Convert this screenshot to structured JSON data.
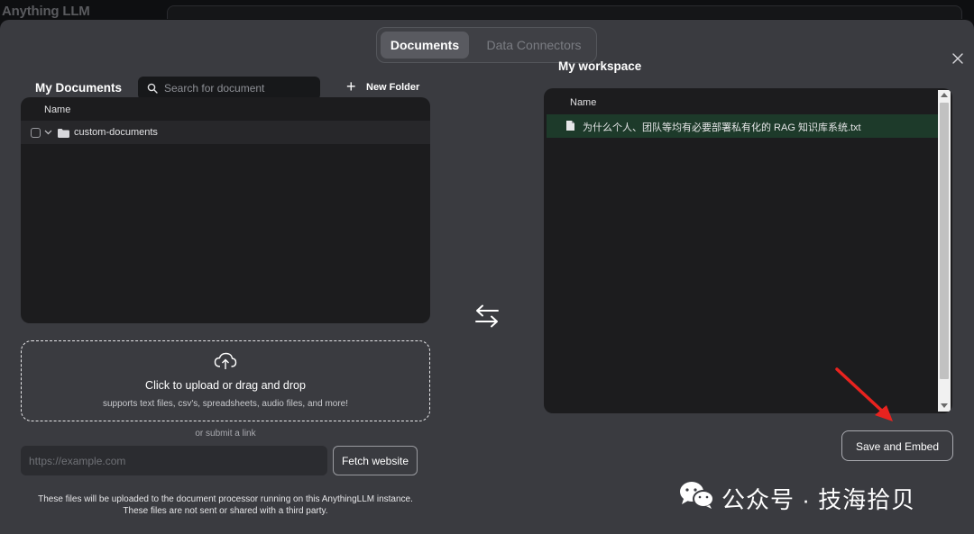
{
  "app": {
    "title": "Anything LLM"
  },
  "tabs": [
    {
      "label": "Documents",
      "active": true
    },
    {
      "label": "Data Connectors",
      "active": false
    }
  ],
  "left": {
    "heading": "My Documents",
    "search_placeholder": "Search for document",
    "new_folder_label": "New Folder",
    "column_name": "Name",
    "folders": [
      {
        "name": "custom-documents",
        "expanded": true,
        "checked": false
      }
    ],
    "upload": {
      "title": "Click to upload or drag and drop",
      "subtitle": "supports text files, csv's, spreadsheets, audio files, and more!"
    },
    "or_submit_link": "or submit a link",
    "url_placeholder": "https://example.com",
    "fetch_label": "Fetch website",
    "disclaimer_line1": "These files will be uploaded to the document processor running on this AnythingLLM instance.",
    "disclaimer_line2": "These files are not sent or shared with a third party."
  },
  "right": {
    "heading": "My workspace",
    "column_name": "Name",
    "files": [
      {
        "name": "为什么个人、团队等均有必要部署私有化的 RAG 知识库系统.txt"
      }
    ],
    "save_label": "Save and Embed"
  },
  "watermark": {
    "text": "公众号 · 技海拾贝"
  },
  "colors": {
    "modal_bg": "#3a3b40",
    "panel_bg": "#1c1c1e",
    "selected_row": "#1d3a2a",
    "annotation_arrow": "#e8231f"
  },
  "icons": [
    "close-icon",
    "search-icon",
    "plus-icon",
    "chevron-down-icon",
    "folder-icon",
    "upload-cloud-icon",
    "swap-arrows-icon",
    "file-icon",
    "wechat-icon"
  ]
}
